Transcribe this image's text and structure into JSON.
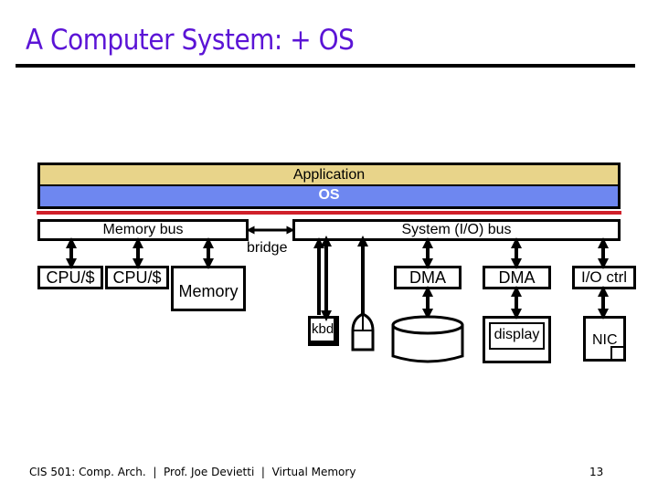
{
  "slide": {
    "title": "A Computer System: + OS",
    "page_number": "13",
    "footer": {
      "course": "CIS 501: Comp. Arch.",
      "separator": "|",
      "instructor": "Prof. Joe Devietti",
      "topic": "Virtual Memory"
    }
  },
  "diagram": {
    "layers": {
      "application": "Application",
      "os": "OS"
    },
    "colors": {
      "title": "#5b14d6",
      "application_layer": "#e8d48a",
      "os_layer": "#6e87f0",
      "separator_line": "#d0202a"
    },
    "buses": {
      "memory_bus": "Memory bus",
      "system_bus": "System (I/O) bus",
      "bridge": "bridge"
    },
    "memory_side": {
      "cpu1": "CPU/$",
      "cpu2": "CPU/$",
      "memory": "Memory"
    },
    "io_side": {
      "keyboard": "kbd",
      "mouse_icon": "mouse-icon",
      "dma1": "DMA",
      "disk": "Disk",
      "dma2": "DMA",
      "display": "display",
      "io_ctrl": "I/O ctrl",
      "nic": "NIC"
    }
  }
}
